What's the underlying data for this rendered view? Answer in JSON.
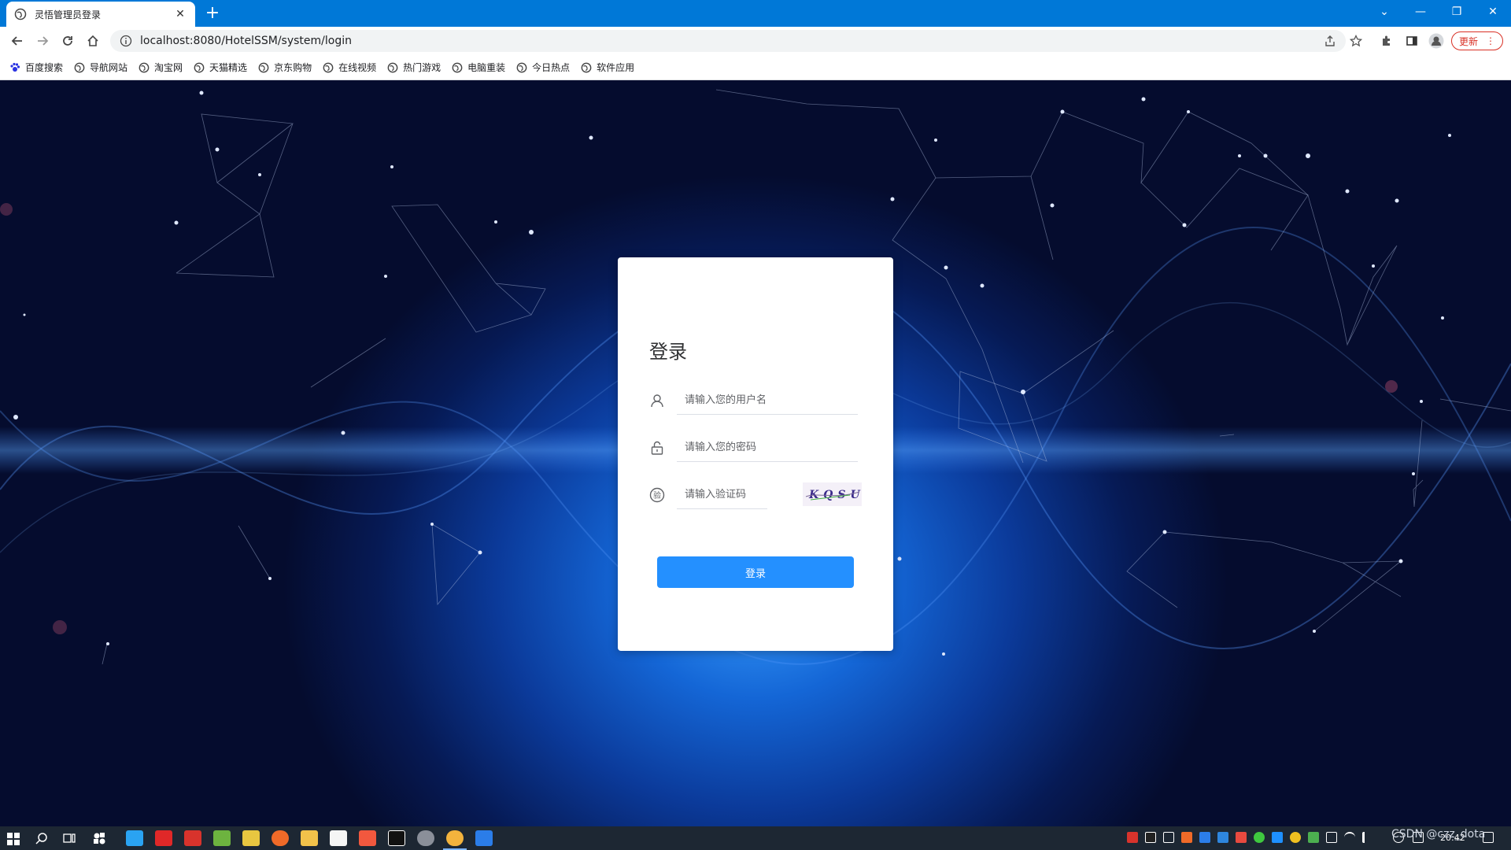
{
  "browser": {
    "tab_title": "灵悟管理员登录",
    "url": "localhost:8080/HotelSSM/system/login",
    "update_label": "更新",
    "new_tab_label": "+",
    "close_tab_label": "✕"
  },
  "bookmarks": [
    {
      "label": "百度搜索",
      "icon": "paw-icon"
    },
    {
      "label": "导航网站",
      "icon": "globe-icon"
    },
    {
      "label": "淘宝网",
      "icon": "globe-icon"
    },
    {
      "label": "天猫精选",
      "icon": "globe-icon"
    },
    {
      "label": "京东购物",
      "icon": "globe-icon"
    },
    {
      "label": "在线视频",
      "icon": "globe-icon"
    },
    {
      "label": "热门游戏",
      "icon": "globe-icon"
    },
    {
      "label": "电脑重装",
      "icon": "globe-icon"
    },
    {
      "label": "今日热点",
      "icon": "globe-icon"
    },
    {
      "label": "软件应用",
      "icon": "globe-icon"
    }
  ],
  "login": {
    "title": "登录",
    "username_placeholder": "请输入您的用户名",
    "password_placeholder": "请输入您的密码",
    "captcha_placeholder": "请输入验证码",
    "captcha_text": "KQSU",
    "submit_label": "登录",
    "captcha_icon_char": "验"
  },
  "taskbar": {
    "clock": "20:42",
    "watermark": "CSDN @czz_dota"
  },
  "colors": {
    "accent": "#2490ff",
    "titlebar": "#0078d7",
    "taskbar": "#1d2733"
  }
}
